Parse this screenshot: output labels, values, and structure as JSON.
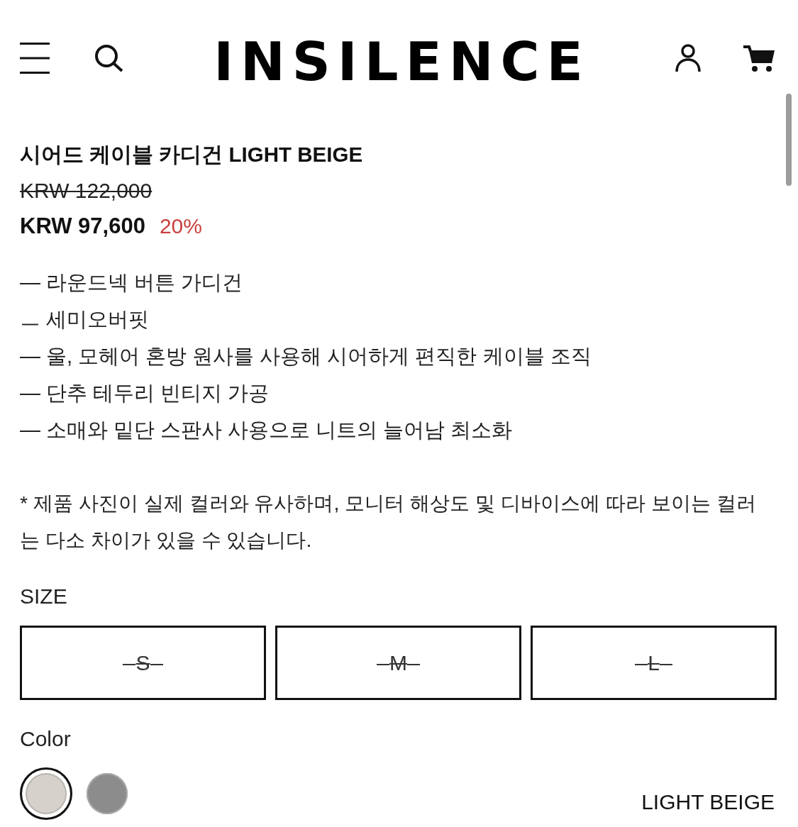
{
  "header": {
    "logo": "INSILENCE"
  },
  "product": {
    "title": "시어드 케이블 카디건 LIGHT BEIGE",
    "original_price": "KRW 122,000",
    "sale_price": "KRW 97,600",
    "discount": "20%"
  },
  "features": [
    "— 라운드넥 버튼 가디건",
    "ㅡ 세미오버핏",
    "— 울, 모헤어 혼방 원사를 사용해 시어하게 편직한 케이블 조직",
    "— 단추 테두리 빈티지 가공",
    "— 소매와 밑단 스판사 사용으로 니트의 늘어남 최소화"
  ],
  "notice": "* 제품 사진이 실제 컬러와 유사하며, 모니터 해상도 및 디바이스에 따라 보이는 컬러는 다소 차이가 있을 수 있습니다.",
  "size": {
    "label": "SIZE",
    "options": [
      {
        "label": "S",
        "sold_out": true
      },
      {
        "label": "M",
        "sold_out": true
      },
      {
        "label": "L",
        "sold_out": true
      }
    ]
  },
  "color": {
    "label": "Color",
    "options": [
      {
        "color": "#d6d2cb",
        "selected": true
      },
      {
        "color": "#8c8c8c",
        "selected": false
      }
    ],
    "selected_name": "LIGHT BEIGE"
  }
}
